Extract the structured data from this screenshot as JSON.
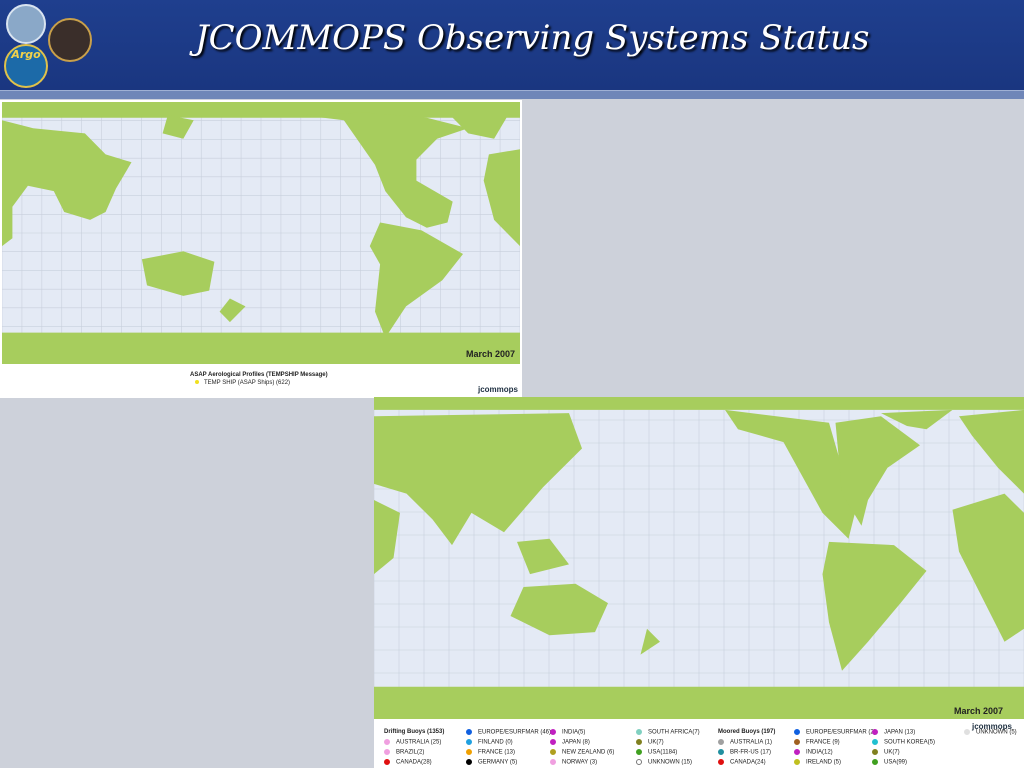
{
  "header": {
    "title": "JCOMMOPS Observing Systems Status",
    "logos": [
      "un-emblem-logo",
      "argo-logo",
      "ship-compass-logo"
    ],
    "argo_text": "Argo"
  },
  "map_top": {
    "date_label": "March 2007",
    "legend_title": "ASAP Aerological Profiles (TEMPSHIP Message)",
    "legend_item": "TEMP SHIP (ASAP Ships) (622)",
    "legend_color": "#f0e020",
    "logo_text": "jcommops"
  },
  "map_bottom": {
    "date_label": "March 2007",
    "logo_text": "jcommops",
    "drifting_header": "Drifting Buoys (1353)",
    "moored_header": "Moored Buoys (197)",
    "drifting": [
      {
        "label": "AUSTRALIA (25)",
        "color": "#f0a0e0"
      },
      {
        "label": "BRAZIL(2)",
        "color": "#f0a0e0"
      },
      {
        "label": "CANADA(28)",
        "color": "#e01010"
      },
      {
        "label": "EUROPE/ESURFMAR (46)",
        "color": "#1060e0"
      },
      {
        "label": "FINLAND (0)",
        "color": "#20a0e0"
      },
      {
        "label": "FRANCE (13)",
        "color": "#f0a000"
      },
      {
        "label": "GERMANY (5)",
        "color": "#000000"
      },
      {
        "label": "INDIA(5)",
        "color": "#c020c0"
      },
      {
        "label": "JAPAN (8)",
        "color": "#c020c0"
      },
      {
        "label": "NEW ZEALAND (6)",
        "color": "#b0a020"
      },
      {
        "label": "NORWAY (3)",
        "color": "#f0a0e0"
      },
      {
        "label": "SOUTH AFRICA(7)",
        "color": "#80d0c0"
      },
      {
        "label": "UK(7)",
        "color": "#808020"
      },
      {
        "label": "USA(1184)",
        "color": "#40a020"
      },
      {
        "label": "UNKNOWN (15)",
        "color": "#ffffff"
      }
    ],
    "moored": [
      {
        "label": "AUSTRALIA (1)",
        "color": "#a0a0a0"
      },
      {
        "label": "BR-FR-US (17)",
        "color": "#2090a0"
      },
      {
        "label": "CANADA(24)",
        "color": "#e01010"
      },
      {
        "label": "EUROPE/ESURFMAR (2)",
        "color": "#1060e0"
      },
      {
        "label": "FRANCE (9)",
        "color": "#a06020"
      },
      {
        "label": "INDIA(12)",
        "color": "#c020c0"
      },
      {
        "label": "IRELAND (5)",
        "color": "#c0c020"
      },
      {
        "label": "JAPAN (13)",
        "color": "#c020c0"
      },
      {
        "label": "SOUTH KOREA(5)",
        "color": "#20c0d0"
      },
      {
        "label": "UK(7)",
        "color": "#808020"
      },
      {
        "label": "USA(99)",
        "color": "#40a020"
      },
      {
        "label": "UNKNOWN (5)",
        "color": "#e0e0e0"
      }
    ]
  },
  "colors": {
    "header_blue": "#1f3f8e",
    "ocean": "#e4eaf5",
    "land": "#a7cd5d",
    "ice": "#a7cd5d",
    "grid": "#c8cfdc",
    "temp_ship": "#f0e020",
    "drifter_usa": "#40a020"
  }
}
